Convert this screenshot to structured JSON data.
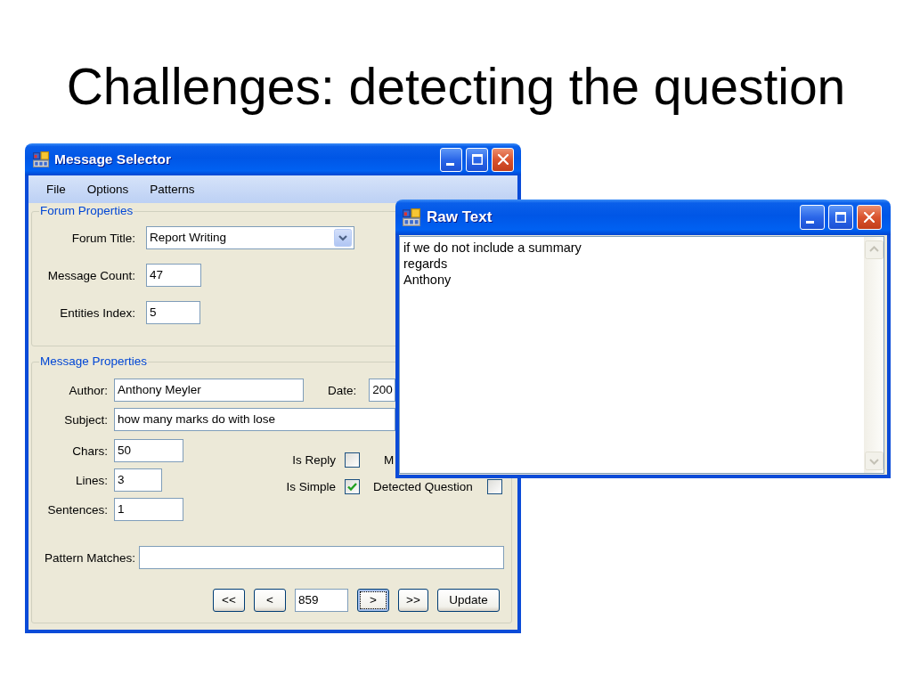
{
  "slide": {
    "title": "Challenges: detecting the question"
  },
  "message_selector": {
    "title": "Message Selector",
    "menu": [
      "File",
      "Options",
      "Patterns"
    ],
    "forum_properties": {
      "legend": "Forum Properties",
      "fields": [
        {
          "kind": "dropdown",
          "label": "Forum Title:",
          "value": "Report Writing"
        },
        {
          "kind": "text",
          "label": "Message Count:",
          "value": "47"
        },
        {
          "kind": "text",
          "label": "Entities Index:",
          "value": "5"
        }
      ]
    },
    "message_properties": {
      "legend": "Message Properties",
      "author": {
        "label": "Author:",
        "value": "Anthony Meyler"
      },
      "date": {
        "label": "Date:",
        "value": "200"
      },
      "subject": {
        "label": "Subject:",
        "value": "how many marks do with lose"
      },
      "counts": [
        {
          "label": "Chars:",
          "value": "50"
        },
        {
          "label": "Lines:",
          "value": "3"
        },
        {
          "label": "Sentences:",
          "value": "1"
        }
      ],
      "flags": [
        {
          "kind": "checkbox",
          "label": "Is Reply",
          "checked": false
        },
        {
          "kind": "label",
          "label": "M"
        },
        {
          "kind": "checkbox",
          "label": "Is Simple",
          "checked": true
        },
        {
          "kind": "checkbox",
          "label": "Detected Question",
          "checked": false
        }
      ],
      "pattern_matches": {
        "label": "Pattern Matches:"
      },
      "navigation": [
        {
          "kind": "button",
          "label": "<<",
          "focused": false
        },
        {
          "kind": "button",
          "label": "<",
          "focused": false
        },
        {
          "kind": "field",
          "value": "859",
          "focused": false
        },
        {
          "kind": "button",
          "label": ">",
          "focused": true
        },
        {
          "kind": "button",
          "label": ">>",
          "focused": false
        },
        {
          "kind": "button",
          "label": "Update",
          "focused": false
        }
      ]
    }
  },
  "raw_text": {
    "title": "Raw Text",
    "lines": [
      "if we do not include a summary",
      "regards",
      "Anthony"
    ]
  }
}
